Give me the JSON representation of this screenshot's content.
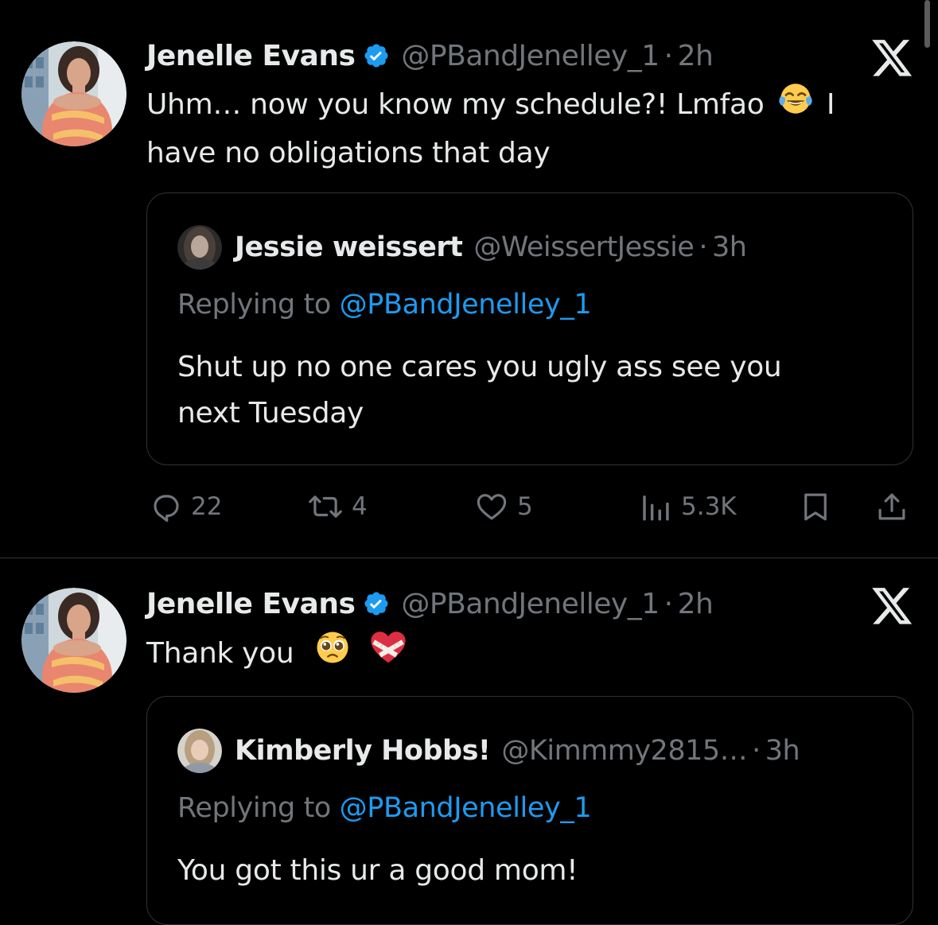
{
  "tweets": [
    {
      "author": {
        "name": "Jenelle Evans",
        "handle": "@PBandJenelley_1",
        "time": "2h",
        "verified": true
      },
      "text_line1": "Uhm… now you know my schedule?! Lmfao",
      "text_line1_end": "I",
      "text_line2": "have no obligations that day",
      "emojis": [
        "tears-of-joy-emoji"
      ],
      "quoted": {
        "author": {
          "name": "Jessie weissert",
          "handle": "@WeissertJessie",
          "time": "3h"
        },
        "replying_prefix": "Replying to",
        "replying_handle": "@PBandJenelley_1",
        "text_line1": "Shut up no one cares you ugly ass see you",
        "text_line2": "next Tuesday"
      },
      "actions": {
        "replies": "22",
        "reposts": "4",
        "likes": "5",
        "views": "5.3K"
      }
    },
    {
      "author": {
        "name": "Jenelle Evans",
        "handle": "@PBandJenelley_1",
        "time": "2h",
        "verified": true
      },
      "text_line1": "Thank you",
      "emojis": [
        "pleading-face-emoji",
        "mending-heart-emoji"
      ],
      "quoted": {
        "author": {
          "name": "Kimberly Hobbs!",
          "handle": "@Kimmmy2815…",
          "time": "3h"
        },
        "replying_prefix": "Replying to",
        "replying_handle": "@PBandJenelley_1",
        "text_line1": "You got this ur a good mom!"
      }
    }
  ],
  "separator": "·",
  "colors": {
    "background": "#000000",
    "primary_text": "#e7e9ea",
    "secondary_text": "#71767b",
    "link": "#1d9bf0",
    "border": "#2f3336",
    "verified": "#1d9bf0"
  }
}
